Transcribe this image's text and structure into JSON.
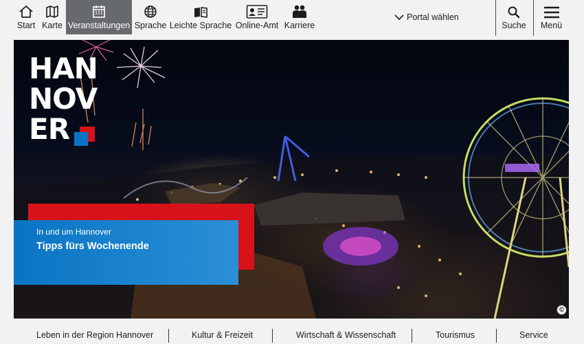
{
  "top_nav": {
    "items": [
      {
        "label": "Start",
        "icon": "home-icon"
      },
      {
        "label": "Karte",
        "icon": "map-icon"
      },
      {
        "label": "Veranstaltungen",
        "icon": "calendar-icon",
        "active": true
      },
      {
        "label": "Sprache",
        "icon": "globe-icon"
      },
      {
        "label": "Leichte Sprache",
        "icon": "book-icon"
      },
      {
        "label": "Online-Amt",
        "icon": "id-card-icon"
      },
      {
        "label": "Karriere",
        "icon": "people-icon"
      }
    ],
    "portal_label": "Portal wählen",
    "search_label": "Suche",
    "menu_label": "Menü"
  },
  "hero": {
    "logo_lines": [
      "HAN",
      "NOV",
      "ER"
    ],
    "kicker": "In und um Hannover",
    "title": "Tipps fürs Wochenende",
    "copyright_symbol": "©"
  },
  "category_nav": {
    "items": [
      "Leben in der Region Hannover",
      "Kultur & Freizeit",
      "Wirtschaft & Wissenschaft",
      "Tourismus",
      "Service"
    ]
  },
  "colors": {
    "active_tab": "#666a6e",
    "brand_red": "#d8121b",
    "brand_blue": "#0a74c4"
  }
}
